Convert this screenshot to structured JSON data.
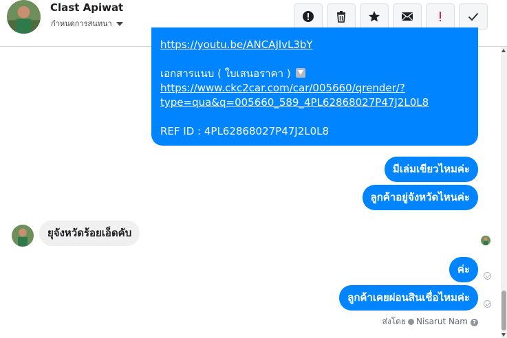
{
  "header": {
    "name": "Clast Apiwat",
    "subtitle": "กำหนดการสนทนา",
    "tools": [
      {
        "icon": "alert-circle-icon"
      },
      {
        "icon": "trash-icon"
      },
      {
        "icon": "star-icon"
      },
      {
        "icon": "envelope-icon"
      },
      {
        "icon": "exclamation-icon",
        "color": "#e41e3f"
      },
      {
        "icon": "checkmark-icon"
      }
    ]
  },
  "colors": {
    "accent": "#0084ff",
    "incoming_bg": "#f1f0f0"
  },
  "messages": {
    "big": {
      "top_link": "https://youtu.be/ANCAJlvL3bY",
      "attach_label": "เอกสารแนบ ( ใบเสนอราคา )",
      "attach_icon": "download-icon",
      "link_line1": "https://www.ckc2car.com/car/005660/qrender/?",
      "link_line2": "type=qua&q=005660_589_4PL62868027P47J2L0L8",
      "ref": "REF ID : 4PL62868027P47J2L0L8"
    },
    "out1": "มีเล่มเขียวไหมค่ะ",
    "out2": "ลูกค้าอยู่จังหวัดไหนค่ะ",
    "in1": "ยุจังหวัดร้อยเอ็ดคับ",
    "out3": "ค่ะ",
    "out4": "ลูกค้าเคยผ่อนสินเชื่อไหมค่ะ"
  },
  "footer": {
    "sent_by_label": "ส่งโดย",
    "sender": "Nisarut Nam"
  }
}
